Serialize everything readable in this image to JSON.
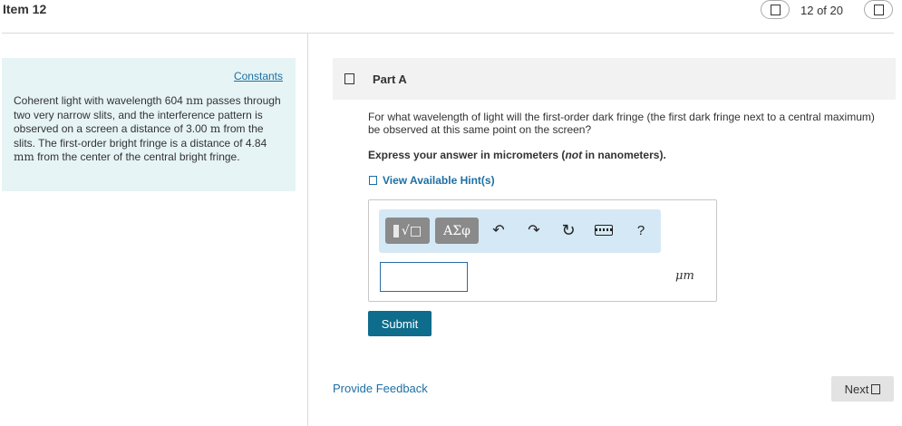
{
  "header": {
    "item_title": "Item 12",
    "counter": "12 of 20",
    "prev_icon": "square-icon",
    "next_icon": "square-icon"
  },
  "constants_panel": {
    "link_label": "Constants",
    "text_parts": [
      "Coherent light with wavelength 604 ",
      "nm",
      " passes through two very narrow slits, and the interference pattern is observed on a screen a distance of 3.00 ",
      "m",
      " from the slits. The first-order bright fringe is a distance of 4.84 ",
      "mm",
      " from the center of the central bright fringe."
    ],
    "background": "#e6f4f6"
  },
  "part": {
    "label": "Part A",
    "question": "For what wavelength of light will the first-order dark fringe (the first dark fringe next to a central maximum) be observed at this same point on the screen?",
    "instruction_prefix": "Express your answer in micrometers (",
    "instruction_emph": "not",
    "instruction_suffix": " in nanometers).",
    "hint_label": "View Available Hint(s)"
  },
  "answer": {
    "toolbar": {
      "templates_symbol": "√□",
      "greek_label": "ΑΣφ",
      "undo_icon": "undo-icon",
      "redo_icon": "redo-icon",
      "reset_icon": "reset-icon",
      "keyboard_icon": "keyboard-icon",
      "help_label": "?"
    },
    "input_value": "",
    "unit": "μm"
  },
  "actions": {
    "submit_label": "Submit",
    "feedback_label": "Provide Feedback",
    "next_label": "Next"
  },
  "colors": {
    "accent": "#0e6c8c",
    "link": "#1d6fa3",
    "toolbar_bg": "#d5e8f5"
  }
}
